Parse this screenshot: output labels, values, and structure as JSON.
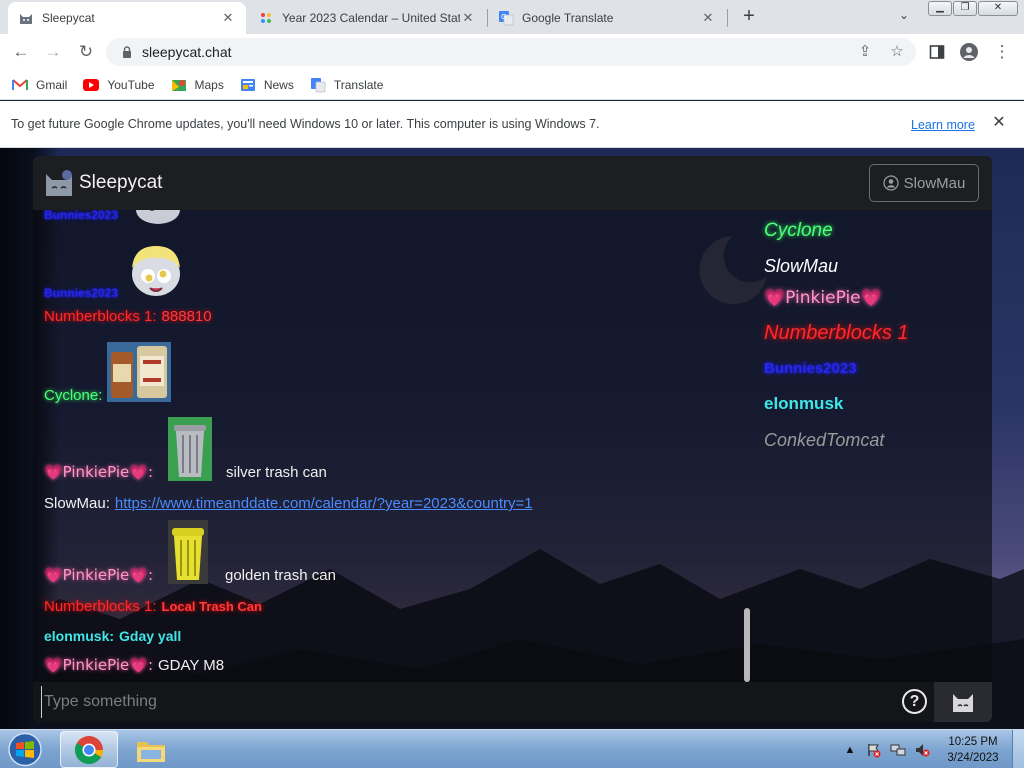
{
  "browser": {
    "tabs": [
      {
        "title": "Sleepycat",
        "icon": "sleepycat-icon",
        "active": true
      },
      {
        "title": "Year 2023 Calendar – United Stat",
        "icon": "calendar-icon",
        "active": false
      },
      {
        "title": "Google Translate",
        "icon": "translate-icon",
        "active": false
      }
    ],
    "url": "sleepycat.chat",
    "bookmarks": [
      {
        "label": "Gmail",
        "icon": "gmail-icon"
      },
      {
        "label": "YouTube",
        "icon": "youtube-icon"
      },
      {
        "label": "Maps",
        "icon": "maps-icon"
      },
      {
        "label": "News",
        "icon": "news-icon"
      },
      {
        "label": "Translate",
        "icon": "translate-icon"
      }
    ],
    "infobar": {
      "message": "To get future Google Chrome updates, you'll need Windows 10 or later. This computer is using Windows 7.",
      "link": "Learn more"
    }
  },
  "app": {
    "title": "Sleepycat",
    "user_button": "SlowMau",
    "input_placeholder": "Type something",
    "help_label": "?",
    "messages": [
      {
        "author": "Bunnies2023",
        "text": "",
        "image": "grey-pony-sticker"
      },
      {
        "author": "Bunnies2023",
        "text": "",
        "image": "derpy-pony-sticker"
      },
      {
        "author": "Numberblocks 1:",
        "text": "888810"
      },
      {
        "author": "Cyclone:",
        "text": "",
        "image": "oil-bottles-sticker"
      },
      {
        "author": "💗PinkiePie💗:",
        "text": "silver trash can",
        "image": "silver-trash-can"
      },
      {
        "author": "SlowMau:",
        "text": "https://www.timeanddate.com/calendar/?year=2023&country=1"
      },
      {
        "author": "💗PinkiePie💗:",
        "text": "golden trash can",
        "image": "golden-trash-can"
      },
      {
        "author": "Numberblocks 1:",
        "text": "Local Trash Can"
      },
      {
        "author": "elonmusk:",
        "text": "Gday yall"
      },
      {
        "author": "💗PinkiePie💗:",
        "text": "GDAY M8"
      }
    ],
    "online_users": [
      {
        "name": "Cyclone",
        "color": "#4dff7a"
      },
      {
        "name": "SlowMau",
        "color": "#ffffff"
      },
      {
        "name": "💗PinkiePie💗",
        "color": "#ff9ac6"
      },
      {
        "name": "Numberblocks 1",
        "color": "#ff2a2a"
      },
      {
        "name": "Bunnies2023",
        "color": "#2a2aff"
      },
      {
        "name": "elonmusk",
        "color": "#3fe8e8"
      },
      {
        "name": "ConkedTomcat",
        "color": "#9a9a9a"
      }
    ]
  },
  "taskbar": {
    "time": "10:25 PM",
    "date": "3/24/2023"
  }
}
